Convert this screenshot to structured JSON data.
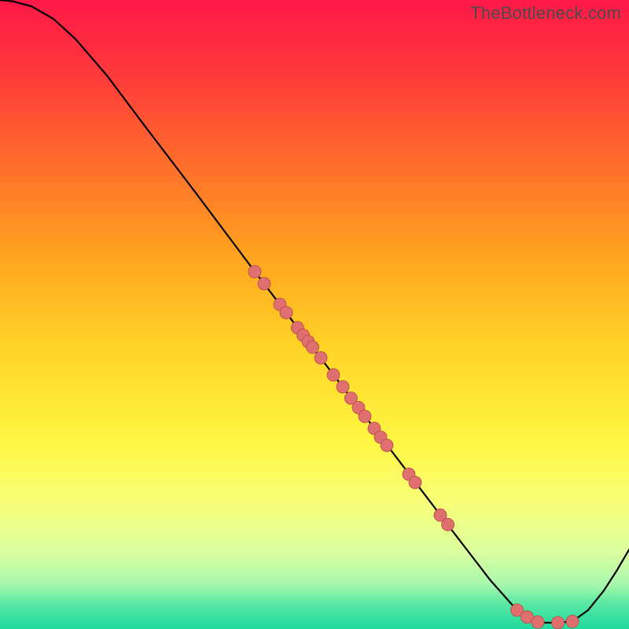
{
  "watermark": "TheBottleneck.com",
  "chart_data": {
    "type": "line",
    "xlim": [
      0,
      1
    ],
    "ylim": [
      0,
      1
    ],
    "grid": false,
    "legend": false,
    "title": "",
    "xlabel": "",
    "ylabel": "",
    "gradient_stops": [
      {
        "offset": 0.0,
        "color": "#ff1848"
      },
      {
        "offset": 0.12,
        "color": "#ff3a3a"
      },
      {
        "offset": 0.25,
        "color": "#ff6a2d"
      },
      {
        "offset": 0.4,
        "color": "#ffa11f"
      },
      {
        "offset": 0.55,
        "color": "#ffd326"
      },
      {
        "offset": 0.7,
        "color": "#fff641"
      },
      {
        "offset": 0.8,
        "color": "#f8ff78"
      },
      {
        "offset": 0.88,
        "color": "#d9ffa0"
      },
      {
        "offset": 0.93,
        "color": "#a6f7ad"
      },
      {
        "offset": 0.96,
        "color": "#58e8a3"
      },
      {
        "offset": 1.0,
        "color": "#1fd99e"
      }
    ],
    "curve": [
      {
        "x": 0.0,
        "y": 1.0
      },
      {
        "x": 0.02,
        "y": 0.998
      },
      {
        "x": 0.05,
        "y": 0.99
      },
      {
        "x": 0.085,
        "y": 0.97
      },
      {
        "x": 0.12,
        "y": 0.938
      },
      {
        "x": 0.17,
        "y": 0.88
      },
      {
        "x": 0.23,
        "y": 0.8
      },
      {
        "x": 0.31,
        "y": 0.695
      },
      {
        "x": 0.4,
        "y": 0.575
      },
      {
        "x": 0.48,
        "y": 0.47
      },
      {
        "x": 0.56,
        "y": 0.365
      },
      {
        "x": 0.64,
        "y": 0.26
      },
      {
        "x": 0.72,
        "y": 0.155
      },
      {
        "x": 0.78,
        "y": 0.077
      },
      {
        "x": 0.82,
        "y": 0.032
      },
      {
        "x": 0.845,
        "y": 0.016
      },
      {
        "x": 0.86,
        "y": 0.01
      },
      {
        "x": 0.885,
        "y": 0.01
      },
      {
        "x": 0.91,
        "y": 0.012
      },
      {
        "x": 0.935,
        "y": 0.03
      },
      {
        "x": 0.96,
        "y": 0.061
      },
      {
        "x": 0.98,
        "y": 0.092
      },
      {
        "x": 1.0,
        "y": 0.126
      }
    ],
    "points": [
      {
        "x": 0.405,
        "y": 0.568
      },
      {
        "x": 0.42,
        "y": 0.549
      },
      {
        "x": 0.445,
        "y": 0.516
      },
      {
        "x": 0.455,
        "y": 0.503
      },
      {
        "x": 0.473,
        "y": 0.479
      },
      {
        "x": 0.482,
        "y": 0.467
      },
      {
        "x": 0.49,
        "y": 0.457
      },
      {
        "x": 0.497,
        "y": 0.448
      },
      {
        "x": 0.51,
        "y": 0.431
      },
      {
        "x": 0.53,
        "y": 0.404
      },
      {
        "x": 0.545,
        "y": 0.385
      },
      {
        "x": 0.558,
        "y": 0.367
      },
      {
        "x": 0.57,
        "y": 0.352
      },
      {
        "x": 0.58,
        "y": 0.338
      },
      {
        "x": 0.595,
        "y": 0.319
      },
      {
        "x": 0.605,
        "y": 0.305
      },
      {
        "x": 0.615,
        "y": 0.292
      },
      {
        "x": 0.65,
        "y": 0.246
      },
      {
        "x": 0.66,
        "y": 0.233
      },
      {
        "x": 0.7,
        "y": 0.181
      },
      {
        "x": 0.712,
        "y": 0.166
      },
      {
        "x": 0.822,
        "y": 0.03
      },
      {
        "x": 0.838,
        "y": 0.019
      },
      {
        "x": 0.855,
        "y": 0.011
      },
      {
        "x": 0.887,
        "y": 0.01
      },
      {
        "x": 0.91,
        "y": 0.012
      }
    ],
    "point_style": {
      "radius": 8,
      "fill": "#e07070",
      "stroke": "#b54848",
      "stroke_width": 0.8
    },
    "curve_style": {
      "stroke": "#000000",
      "width": 2.2
    }
  }
}
